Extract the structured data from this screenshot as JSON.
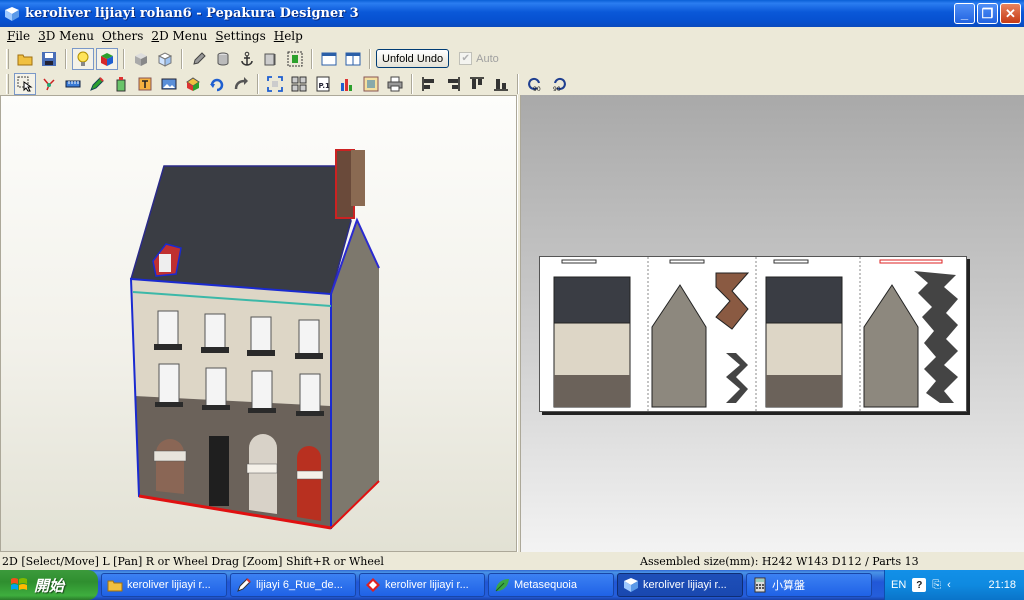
{
  "window": {
    "title": "keroliver lijiayi rohan6 - Pepakura Designer 3"
  },
  "menu": [
    "File",
    "3D Menu",
    "Others",
    "2D Menu",
    "Settings",
    "Help"
  ],
  "toolbar": {
    "unfold_undo_label": "Unfold Undo",
    "auto_label": "Auto",
    "auto_checked": true
  },
  "status": {
    "left": "2D [Select/Move] L [Pan] R or Wheel Drag [Zoom] Shift+R or Wheel",
    "right": "Assembled size(mm): H242 W143 D112 / Parts 13"
  },
  "taskbar": {
    "start_label": "開始",
    "tasks": [
      {
        "label": "keroliver lijiayi r...",
        "icon": "folder-icon"
      },
      {
        "label": "lijiayi 6_Rue_de...",
        "icon": "pen-icon"
      },
      {
        "label": "keroliver lijiayi r...",
        "icon": "paper-craft-icon"
      },
      {
        "label": "Metasequoia",
        "icon": "leaf-icon"
      },
      {
        "label": "keroliver lijiayi r...",
        "icon": "pepakura-icon",
        "active": true
      },
      {
        "label": "小算盤",
        "icon": "calculator-icon"
      }
    ],
    "tray": {
      "lang": "EN",
      "clock": "21:18"
    }
  }
}
